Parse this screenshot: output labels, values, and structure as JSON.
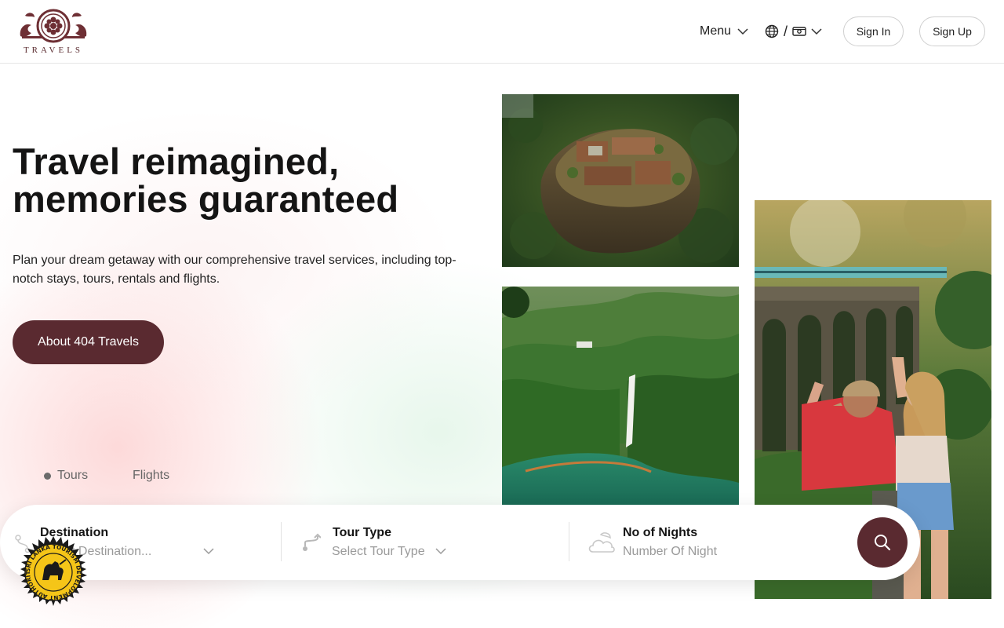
{
  "brand": {
    "logo_text": "TRAVELS"
  },
  "nav": {
    "menu_label": "Menu",
    "lang_separator": "/",
    "sign_in": "Sign In",
    "sign_up": "Sign Up"
  },
  "hero": {
    "headline_line1": "Travel reimagined,",
    "headline_line2": "memories guaranteed",
    "subtext": "Plan your dream getaway with our comprehensive travel services, including top-notch stays, tours, rentals and flights.",
    "cta_label": "About 404 Travels"
  },
  "tabs": [
    {
      "label": "Tours",
      "active": true
    },
    {
      "label": "Flights",
      "active": false
    }
  ],
  "search": {
    "destination": {
      "label": "Destination",
      "placeholder": "Select Destination..."
    },
    "tour_type": {
      "label": "Tour Type",
      "placeholder": "Select Tour Type"
    },
    "nights": {
      "label": "No of Nights",
      "placeholder": "Number Of Night"
    }
  },
  "seal": {
    "text": "SRI LANKA TOURISM DEVELOPMENT AUTHORITY"
  },
  "colors": {
    "brand": "#5a2a30",
    "muted_text": "#9a9a9a"
  },
  "icons": [
    "chevron-down-icon",
    "globe-icon",
    "currency-icon",
    "route-icon",
    "weather-icon",
    "search-icon"
  ]
}
